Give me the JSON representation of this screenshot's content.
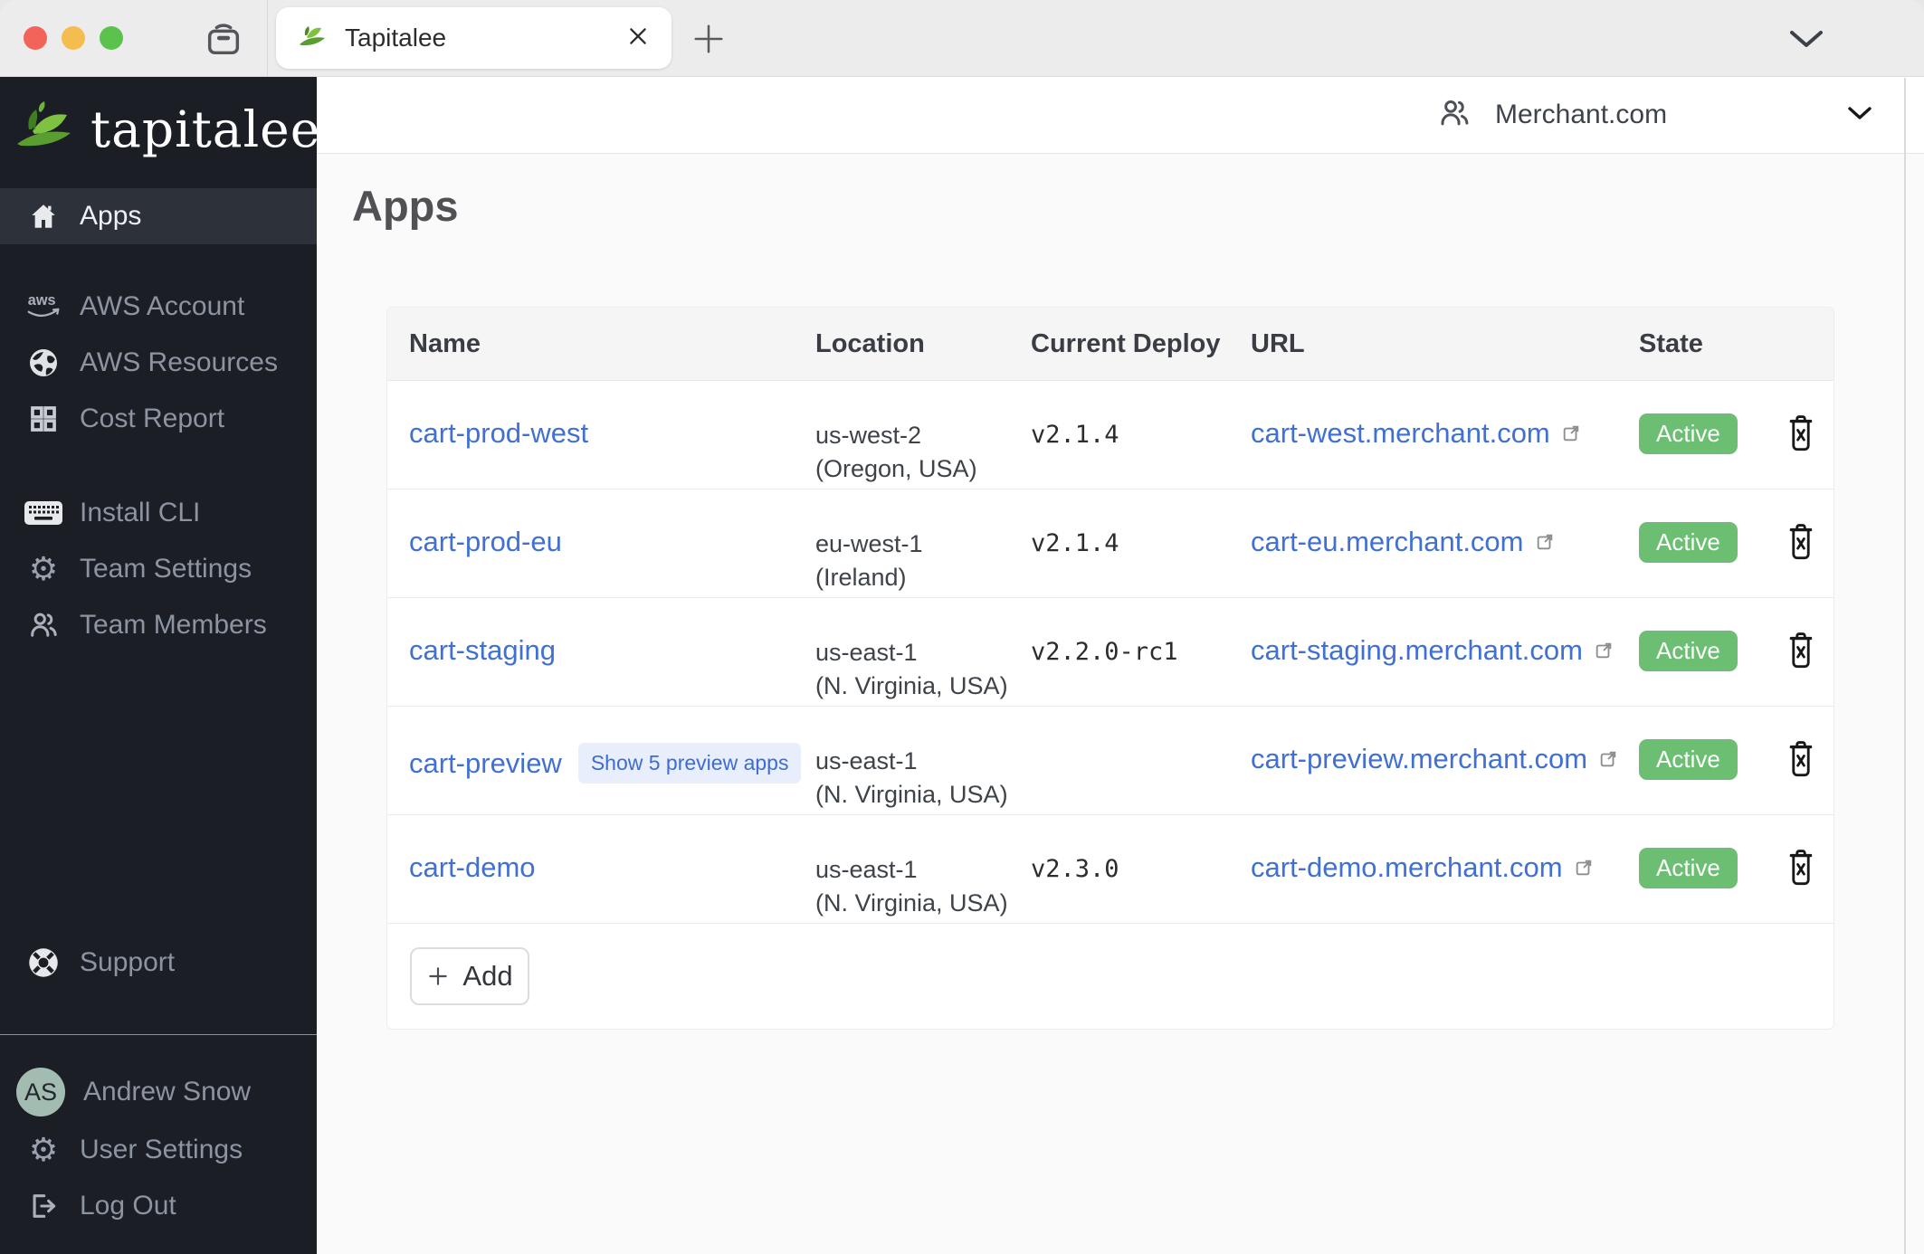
{
  "browser": {
    "tab_title": "Tapitalee"
  },
  "brand": {
    "name": "tapitalee"
  },
  "sidebar": {
    "items": [
      {
        "label": "Apps",
        "icon": "home-icon",
        "active": true
      },
      {
        "label": "AWS Account",
        "icon": "aws-icon"
      },
      {
        "label": "AWS Resources",
        "icon": "globe-icon"
      },
      {
        "label": "Cost Report",
        "icon": "grid-icon"
      },
      {
        "label": "Install CLI",
        "icon": "keyboard-icon"
      },
      {
        "label": "Team Settings",
        "icon": "gear-icon"
      },
      {
        "label": "Team Members",
        "icon": "people-icon"
      },
      {
        "label": "Support",
        "icon": "lifebuoy-icon"
      }
    ],
    "user": {
      "initials": "AS",
      "name": "Andrew Snow"
    },
    "user_items": [
      {
        "label": "User Settings",
        "icon": "gear-icon"
      },
      {
        "label": "Log Out",
        "icon": "logout-icon"
      }
    ]
  },
  "header": {
    "account": "Merchant.com"
  },
  "page": {
    "title": "Apps"
  },
  "table": {
    "columns": [
      "Name",
      "Location",
      "Current Deploy",
      "URL",
      "State"
    ],
    "rows": [
      {
        "name": "cart-prod-west",
        "location_line1": "us-west-2",
        "location_line2": "(Oregon, USA)",
        "deploy": "v2.1.4",
        "url": "cart-west.merchant.com",
        "state": "Active"
      },
      {
        "name": "cart-prod-eu",
        "location_line1": "eu-west-1",
        "location_line2": "(Ireland)",
        "deploy": "v2.1.4",
        "url": "cart-eu.merchant.com",
        "state": "Active"
      },
      {
        "name": "cart-staging",
        "location_line1": "us-east-1",
        "location_line2": "(N. Virginia, USA)",
        "deploy": "v2.2.0-rc1",
        "url": "cart-staging.merchant.com",
        "state": "Active"
      },
      {
        "name": "cart-preview",
        "chip": "Show 5 preview apps",
        "location_line1": "us-east-1",
        "location_line2": "(N. Virginia, USA)",
        "deploy": "",
        "url": "cart-preview.merchant.com",
        "state": "Active"
      },
      {
        "name": "cart-demo",
        "location_line1": "us-east-1",
        "location_line2": "(N. Virginia, USA)",
        "deploy": "v2.3.0",
        "url": "cart-demo.merchant.com",
        "state": "Active"
      }
    ],
    "add_label": "Add"
  },
  "colors": {
    "sidebar_bg": "#1b1e24",
    "active_item_bg": "#2d323a",
    "badge_green": "#6cbf72",
    "link_blue": "#4170d4",
    "chip_bg": "#e8eefb",
    "chip_text": "#3e6cd2",
    "avatar_bg": "#a3bcb1",
    "brand_green": "#5a9e32"
  }
}
